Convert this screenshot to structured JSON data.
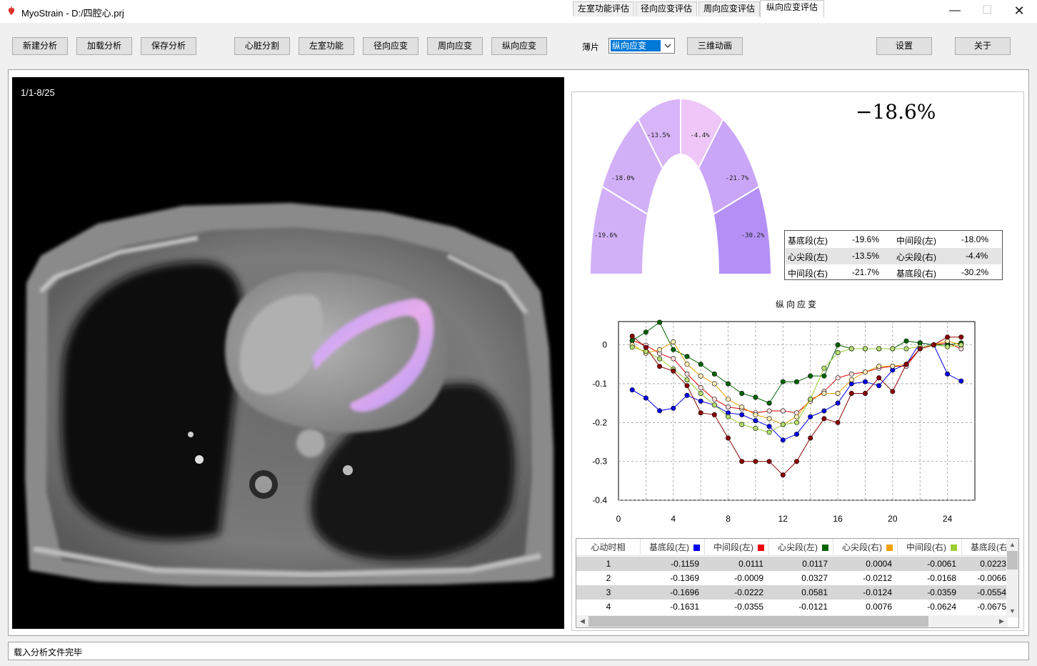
{
  "window": {
    "title": "MyoStrain - D:/四腔心.prj",
    "min_glyph": "—",
    "max_glyph": "☐",
    "close_glyph": "✕"
  },
  "toolbar": {
    "buttons": [
      "新建分析",
      "加载分析",
      "保存分析",
      "心脏分割",
      "左室功能",
      "径向应变",
      "周向应变",
      "纵向应变",
      "三维动画",
      "设置",
      "关于"
    ],
    "slice_label": "薄片",
    "slice_value": "纵向应变"
  },
  "viewer": {
    "frame_label": "1/1-8/25"
  },
  "tabs": [
    "左室功能评估",
    "径向应变评估",
    "周向应变评估",
    "纵向应变评估"
  ],
  "active_tab": 3,
  "bullseye": {
    "global_value": "−18.6%",
    "segments": [
      "-19.6%",
      "-18.0%",
      "-13.5%",
      "-4.4%",
      "-21.7%",
      "-30.2%"
    ],
    "segment_colors": [
      "#d2b0f8",
      "#d2b0f8",
      "#d8b4f8",
      "#eec6f8",
      "#c9a6f8",
      "#b490f6"
    ]
  },
  "segment_table": [
    [
      "基底段(左)",
      "-19.6%",
      "中间段(左)",
      "-18.0%"
    ],
    [
      "心尖段(左)",
      "-13.5%",
      "心尖段(右)",
      "-4.4%"
    ],
    [
      "中间段(右)",
      "-21.7%",
      "基底段(右)",
      "-30.2%"
    ]
  ],
  "chart_data": {
    "type": "line",
    "title": "纵向应变",
    "xlabel": "",
    "ylabel": "",
    "xlim": [
      0,
      26
    ],
    "ylim": [
      -0.4,
      0.06
    ],
    "xticks": [
      0,
      4,
      8,
      12,
      16,
      20,
      24
    ],
    "yticks": [
      0,
      -0.1,
      -0.2,
      -0.3,
      -0.4
    ],
    "ytick_labels": [
      "0",
      "-0.1",
      "-0.2",
      "-0.3",
      "-0.4"
    ],
    "grid": true,
    "x": [
      1,
      2,
      3,
      4,
      5,
      6,
      7,
      8,
      9,
      10,
      11,
      12,
      13,
      14,
      15,
      16,
      17,
      18,
      19,
      20,
      21,
      22,
      23,
      24,
      25
    ],
    "series": [
      {
        "color": "#0000ee",
        "fill": "#0000ee",
        "values": [
          -0.1159,
          -0.1369,
          -0.1696,
          -0.1631,
          -0.13,
          -0.145,
          -0.155,
          -0.175,
          -0.18,
          -0.195,
          -0.21,
          -0.245,
          -0.23,
          -0.185,
          -0.17,
          -0.15,
          -0.1,
          -0.095,
          -0.105,
          -0.065,
          -0.05,
          0.005,
          0.0,
          -0.075,
          -0.093
        ]
      },
      {
        "color": "#dd0000",
        "fill": "#ffdddd",
        "values": [
          0.0111,
          -0.0009,
          -0.0222,
          -0.0355,
          -0.075,
          -0.11,
          -0.14,
          -0.16,
          -0.165,
          -0.175,
          -0.17,
          -0.17,
          -0.175,
          -0.145,
          -0.12,
          -0.085,
          -0.075,
          -0.07,
          -0.06,
          -0.055,
          -0.055,
          -0.01,
          0.0,
          0.005,
          -0.01
        ]
      },
      {
        "color": "#006400",
        "fill": "#006400",
        "values": [
          0.0117,
          0.0327,
          0.0581,
          -0.0121,
          -0.03,
          -0.05,
          -0.075,
          -0.1,
          -0.125,
          -0.135,
          -0.15,
          -0.095,
          -0.095,
          -0.08,
          -0.08,
          0.0,
          -0.01,
          -0.01,
          -0.01,
          -0.01,
          0.01,
          0.005,
          0.0,
          0.0,
          0.005
        ]
      },
      {
        "color": "#e8a000",
        "fill": "#ffeebb",
        "values": [
          0.0004,
          -0.0212,
          -0.0124,
          0.0076,
          -0.05,
          -0.08,
          -0.1,
          -0.14,
          -0.16,
          -0.18,
          -0.19,
          -0.205,
          -0.185,
          -0.14,
          -0.125,
          -0.125,
          -0.09,
          -0.07,
          -0.055,
          -0.055,
          -0.05,
          -0.01,
          0.0,
          0.01,
          0.0
        ]
      },
      {
        "color": "#9acd32",
        "fill": "#b8e070",
        "values": [
          -0.0061,
          -0.0168,
          -0.0359,
          -0.0624,
          -0.09,
          -0.125,
          -0.155,
          -0.185,
          -0.205,
          -0.215,
          -0.225,
          -0.205,
          -0.2,
          -0.14,
          -0.06,
          -0.02,
          -0.01,
          -0.01,
          -0.01,
          -0.01,
          -0.01,
          -0.005,
          0.0,
          -0.005,
          0.0
        ]
      },
      {
        "color": "#8b0000",
        "fill": "#8b0000",
        "values": [
          0.0223,
          -0.0066,
          -0.0554,
          -0.0675,
          -0.105,
          -0.175,
          -0.18,
          -0.24,
          -0.3,
          -0.3,
          -0.3,
          -0.335,
          -0.3,
          -0.24,
          -0.19,
          -0.2,
          -0.125,
          -0.125,
          -0.085,
          -0.12,
          -0.05,
          -0.01,
          0.0,
          0.02,
          0.02
        ]
      }
    ]
  },
  "strain_grid": {
    "columns": [
      "心动时相",
      "基底段(左)",
      "中间段(左)",
      "心尖段(左)",
      "心尖段(右)",
      "中间段(右)",
      "基底段(右)"
    ],
    "swatches": [
      "",
      "#0000ee",
      "#ee0000",
      "#006400",
      "#f0a000",
      "#9acd32",
      ""
    ],
    "rows": [
      [
        "1",
        "-0.1159",
        "0.0111",
        "0.0117",
        "0.0004",
        "-0.0061",
        "0.0223"
      ],
      [
        "2",
        "-0.1369",
        "-0.0009",
        "0.0327",
        "-0.0212",
        "-0.0168",
        "-0.0066"
      ],
      [
        "3",
        "-0.1696",
        "-0.0222",
        "0.0581",
        "-0.0124",
        "-0.0359",
        "-0.0554"
      ],
      [
        "4",
        "-0.1631",
        "-0.0355",
        "-0.0121",
        "0.0076",
        "-0.0624",
        "-0.0675"
      ]
    ]
  },
  "status": {
    "text": "载入分析文件完毕"
  }
}
